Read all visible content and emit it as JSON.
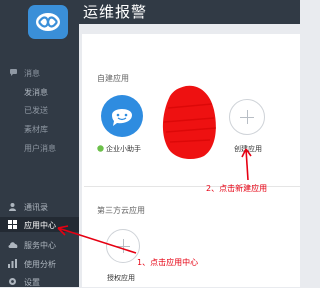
{
  "app": {
    "title": "运维报警",
    "brand_color": "#3a8fd8",
    "sidebar_color": "#313a45"
  },
  "sidebar": {
    "message_header": "消息",
    "message_items": [
      "发消息",
      "已发送",
      "素材库",
      "用户消息"
    ],
    "items": [
      {
        "label": "通讯录",
        "icon": "contacts-icon"
      },
      {
        "label": "应用中心",
        "icon": "apps-grid-icon"
      },
      {
        "label": "服务中心",
        "icon": "cloud-icon"
      },
      {
        "label": "使用分析",
        "icon": "bar-chart-icon"
      },
      {
        "label": "设置",
        "icon": "gear-icon"
      }
    ],
    "active_item": "应用中心"
  },
  "main": {
    "custom_apps_label": "自建应用",
    "custom_apps": [
      {
        "name": "企业小助手",
        "icon": "chat-bubble-icon"
      },
      {
        "name": "",
        "icon": "redacted-icon"
      }
    ],
    "add_custom_label": "创建应用",
    "third_party_label": "第三方云应用",
    "add_third_party_label": "授权应用"
  },
  "annotations": {
    "step1": "1、点击应用中心",
    "step2": "2、点击新建应用",
    "color": "#e60012"
  }
}
